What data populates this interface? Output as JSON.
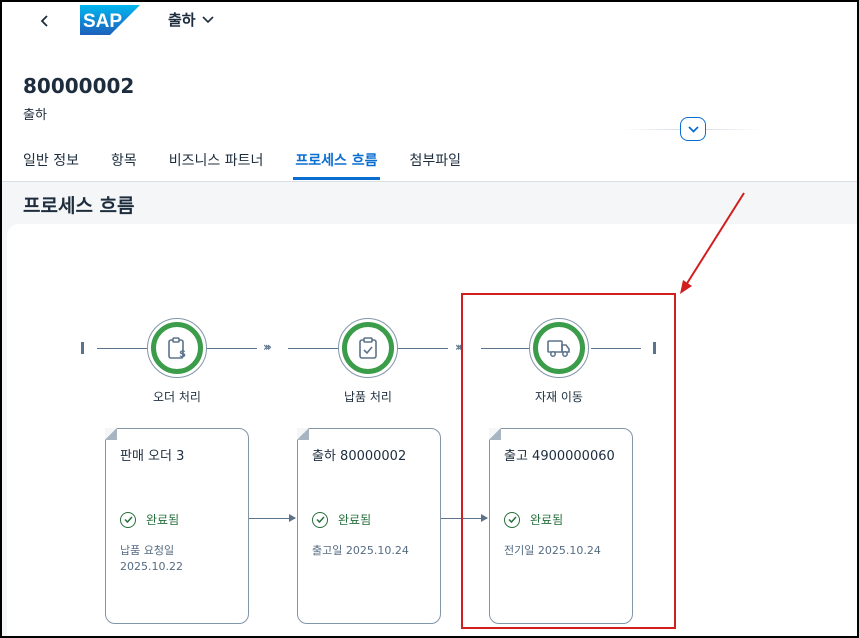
{
  "shell": {
    "back_icon": "chevron-left-icon",
    "logo": "SAP",
    "app_title": "출하",
    "app_title_icon": "chevron-down-icon"
  },
  "object_header": {
    "title": "80000002",
    "subtitle": "출하",
    "collapse_icon": "chevron-down-icon"
  },
  "tabs": [
    {
      "label": "일반 정보",
      "active": false
    },
    {
      "label": "항목",
      "active": false
    },
    {
      "label": "비즈니스 파트너",
      "active": false
    },
    {
      "label": "프로세스 흐름",
      "active": true
    },
    {
      "label": "첨부파일",
      "active": false
    }
  ],
  "section": {
    "title": "프로세스 흐름"
  },
  "process_flow": {
    "nodes": [
      {
        "label": "오더 처리",
        "icon": "clipboard-dollar-icon",
        "status_color": "#3b9c49"
      },
      {
        "label": "납품 처리",
        "icon": "clipboard-check-icon",
        "status_color": "#3b9c49"
      },
      {
        "label": "자재 이동",
        "icon": "truck-icon",
        "status_color": "#3b9c49"
      }
    ],
    "documents": [
      {
        "title": "판매 오더 3",
        "status": "완료됨",
        "info_label": "납품 요청일",
        "info_value": "2025.10.22"
      },
      {
        "title": "출하 80000002",
        "status": "완료됨",
        "info_label": "출고일",
        "info_value": "2025.10.24"
      },
      {
        "title": "출고 4900000060",
        "status": "완료됨",
        "info_label": "전기일",
        "info_value": "2025.10.24"
      }
    ]
  },
  "colors": {
    "accent": "#0a6ed1",
    "success": "#3b9c49",
    "annotation": "#d11f1f"
  }
}
